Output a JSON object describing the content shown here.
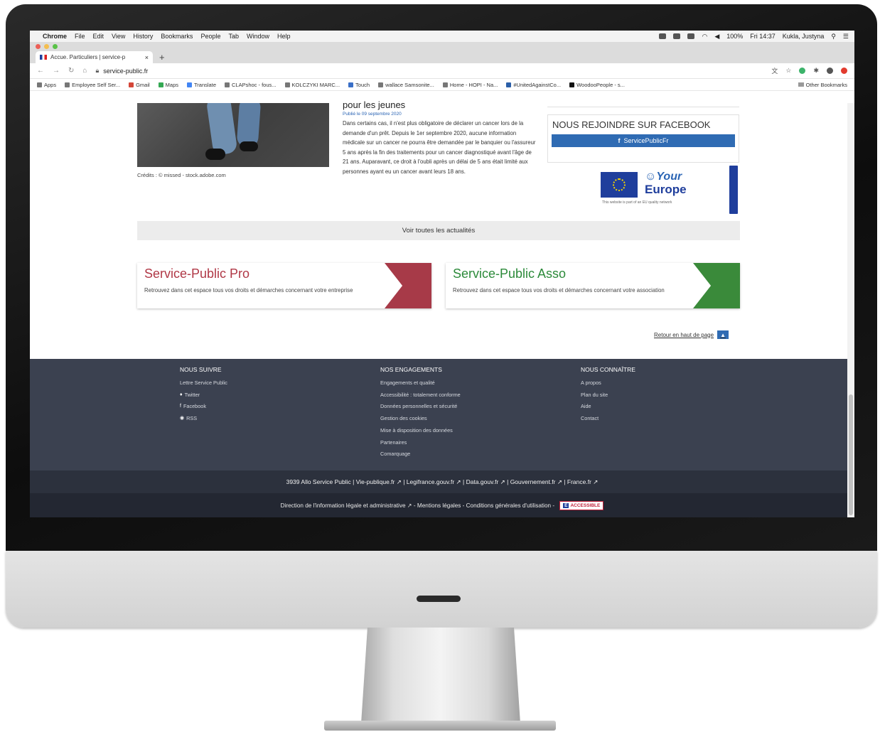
{
  "menubar": {
    "app": "Chrome",
    "items": [
      "File",
      "Edit",
      "View",
      "History",
      "Bookmarks",
      "People",
      "Tab",
      "Window",
      "Help"
    ],
    "battery": "100%",
    "clock": "Fri 14:37",
    "user": "Kukla, Justyna"
  },
  "browser": {
    "tab_title": "Accue. Particuliers | service-p",
    "url": "service-public.fr",
    "bookmarks": [
      "Apps",
      "Employee Self Ser...",
      "Gmail",
      "Maps",
      "Translate",
      "CLAPshoc - fous...",
      "KOLCZYKI MARC...",
      "Touch",
      "wallace Samsonite...",
      "Home - HOPI - Na...",
      "#UnitedAgainstCo...",
      "WoodooPeople - s..."
    ],
    "other_bookmarks": "Other Bookmarks"
  },
  "page": {
    "photo_credit": "Crédits : © missed - stock.adobe.com",
    "article": {
      "title": "pour les jeunes",
      "date": "Publié le 09 septembre 2020",
      "body": "Dans certains cas, il n'est plus obligatoire de déclarer un cancer lors de la demande d'un prêt. Depuis le 1er septembre 2020, aucune information médicale sur un cancer ne pourra être demandée par le banquier ou l'assureur 5 ans après la fin des traitements pour un cancer diagnostiqué avant l'âge de 21 ans. Auparavant, ce droit à l'oubli après un délai de 5 ans était limité aux personnes ayant eu un cancer avant leurs 18 ans."
    },
    "facebook": {
      "heading": "NOUS REJOINDRE SUR FACEBOOK",
      "button": "ServicePublicFr"
    },
    "eu_badge": {
      "line1": "Your",
      "line2": "Europe",
      "note": "This website is part of an EU quality network"
    },
    "see_all": "Voir toutes les actualités",
    "promo_pro": {
      "title": "Service-Public Pro",
      "desc": "Retrouvez dans cet espace tous vos droits et démarches concernant votre entreprise"
    },
    "promo_asso": {
      "title": "Service-Public Asso",
      "desc": "Retrouvez dans cet espace tous vos droits et démarches concernant votre association"
    },
    "back_to_top": "Retour en haut de page"
  },
  "footer": {
    "col1": {
      "heading": "NOUS SUIVRE",
      "items": [
        "Lettre Service Public",
        "Twitter",
        "Facebook",
        "RSS"
      ]
    },
    "col2": {
      "heading": "NOS ENGAGEMENTS",
      "items": [
        "Engagements et qualité",
        "Accessibilité : totalement conforme",
        "Données personnelles et sécurité",
        "Gestion des cookies",
        "Mise à disposition des données",
        "Partenaires",
        "Comarquage"
      ]
    },
    "col3": {
      "heading": "NOUS CONNAÎTRE",
      "items": [
        "A propos",
        "Plan du site",
        "Aide",
        "Contact"
      ]
    },
    "links_line": "3939 Allo Service Public | Vie-publique.fr ↗ | Legifrance.gouv.fr ↗ | Data.gouv.fr ↗ | Gouvernement.fr ↗ | France.fr ↗",
    "legal_line": "Direction de l'information légale et administrative ↗ - Mentions légales - Conditions générales d'utilisation -",
    "accessible_badge": "ACCESSIBLE"
  },
  "colors": {
    "footer_bg": "#3b4150",
    "pro_accent": "#a73a48",
    "asso_accent": "#3a8a3a",
    "fb_blue": "#2f6bb3"
  }
}
